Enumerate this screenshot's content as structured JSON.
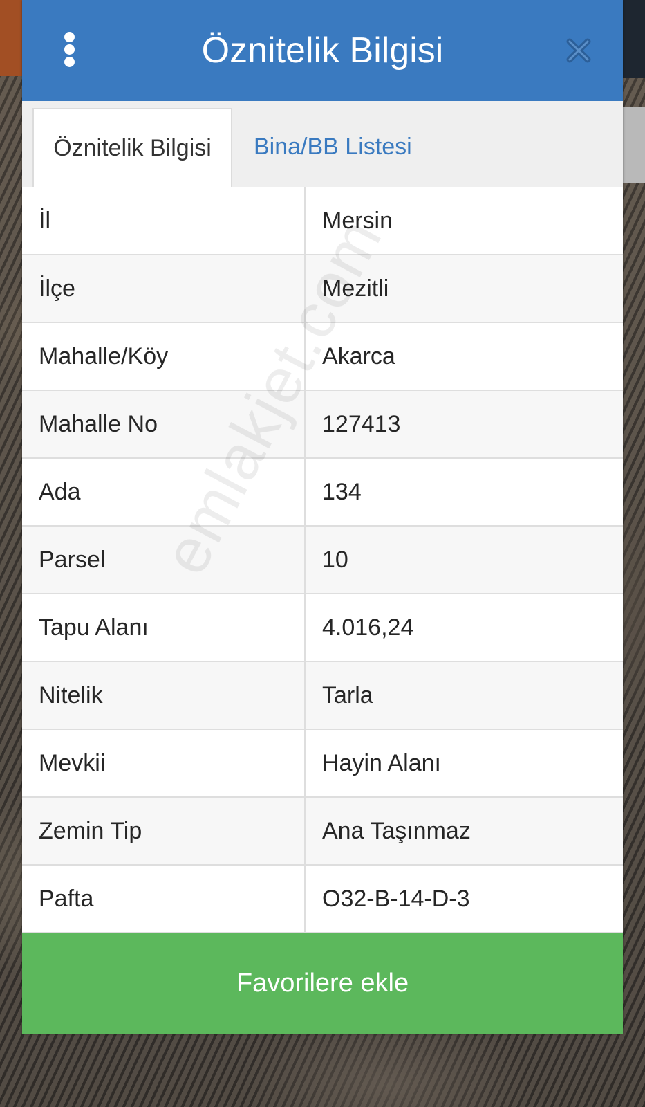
{
  "header": {
    "title": "Öznitelik Bilgisi"
  },
  "tabs": [
    {
      "label": "Öznitelik Bilgisi",
      "active": true
    },
    {
      "label": "Bina/BB Listesi",
      "active": false
    }
  ],
  "attributes": [
    {
      "key": "İl",
      "value": "Mersin"
    },
    {
      "key": "İlçe",
      "value": "Mezitli"
    },
    {
      "key": "Mahalle/Köy",
      "value": "Akarca"
    },
    {
      "key": "Mahalle No",
      "value": "127413"
    },
    {
      "key": "Ada",
      "value": "134"
    },
    {
      "key": "Parsel",
      "value": "10"
    },
    {
      "key": "Tapu Alanı",
      "value": "4.016,24"
    },
    {
      "key": "Nitelik",
      "value": "Tarla"
    },
    {
      "key": "Mevkii",
      "value": "Hayin Alanı"
    },
    {
      "key": "Zemin Tip",
      "value": "Ana Taşınmaz"
    },
    {
      "key": "Pafta",
      "value": "O32-B-14-D-3"
    }
  ],
  "footer": {
    "favorite_label": "Favorilere ekle"
  },
  "watermark": "emlakjet.com",
  "icons": {
    "menu": "kebab-menu-icon",
    "close": "close-icon"
  },
  "colors": {
    "header_bg": "#3a7ac0",
    "button_bg": "#5cb85c",
    "tab_link": "#3a7ac0"
  }
}
